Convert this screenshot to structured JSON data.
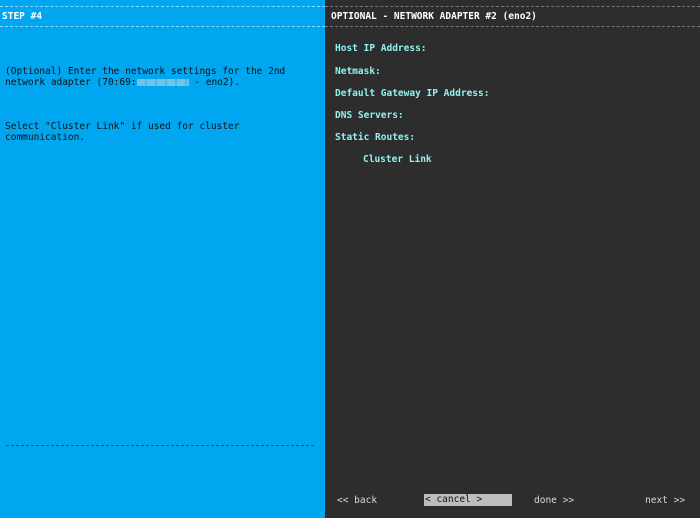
{
  "left": {
    "title": "STEP #4",
    "description_line1": "(Optional) Enter the network settings for the 2nd",
    "description_line2_pre": "network adapter (70:69:",
    "description_line2_post": " - eno2).",
    "description_line3": "Select \"Cluster Link\" if used for cluster",
    "description_line4": "communication."
  },
  "right": {
    "title": "OPTIONAL - NETWORK ADAPTER #2 (eno2)",
    "fields": {
      "host_ip": "Host IP Address:",
      "netmask": "Netmask:",
      "gateway": "Default Gateway IP Address:",
      "dns": "DNS Servers:",
      "static_routes": "Static Routes:"
    },
    "cluster_link": "Cluster Link"
  },
  "nav": {
    "back": "<< back",
    "cancel": "< cancel >",
    "done": "done >>",
    "next": "next >>"
  },
  "colors": {
    "left_bg": "#00a6ef",
    "right_bg": "#2d2d2d",
    "field_text": "#8ff3f0",
    "selected_button_bg": "#bdbdbd"
  }
}
